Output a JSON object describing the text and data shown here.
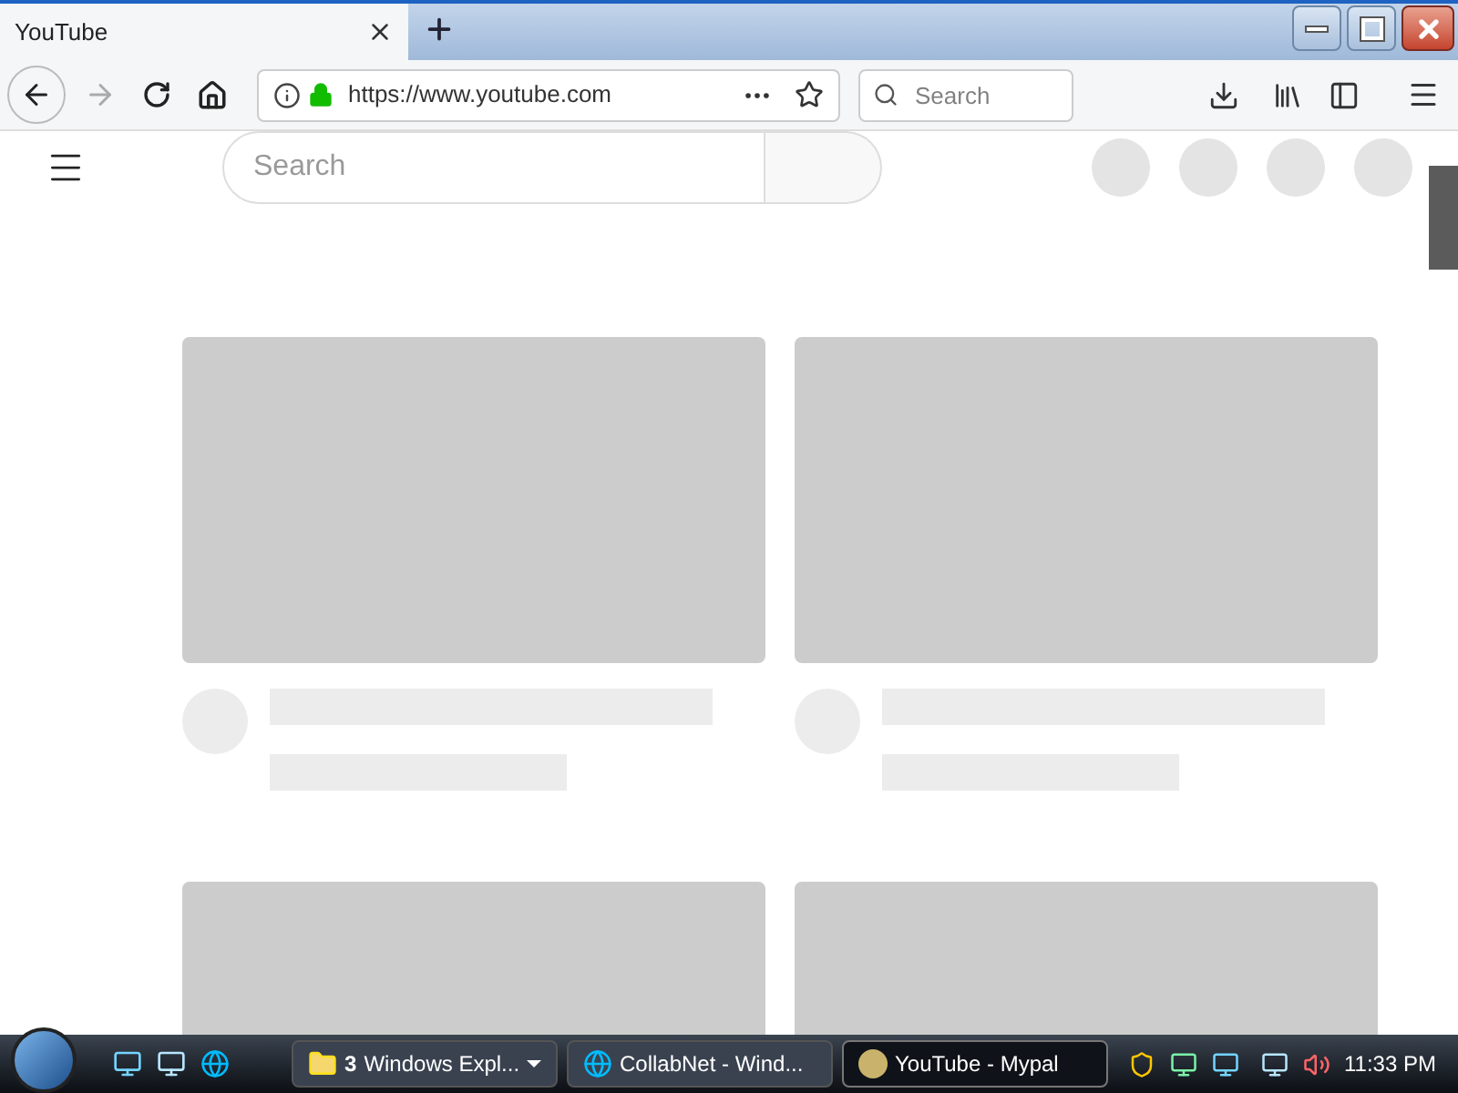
{
  "browser": {
    "tab": {
      "title": "YouTube",
      "selected": true
    },
    "url": "https://www.youtube.com",
    "search": {
      "placeholder": "Search"
    }
  },
  "page": {
    "search": {
      "placeholder": "Search"
    },
    "feed": [
      {
        "kind": "skeleton"
      },
      {
        "kind": "skeleton"
      },
      {
        "kind": "thumbnail"
      },
      {
        "kind": "thumbnail"
      }
    ]
  },
  "taskbar": {
    "items": [
      {
        "count": "3",
        "label": "Windows Expl...",
        "selected": false,
        "grouped": true
      },
      {
        "label": "CollabNet - Wind...",
        "selected": false,
        "grouped": false
      },
      {
        "label": "YouTube - Mypal",
        "selected": true,
        "grouped": false
      }
    ],
    "clock": "11:33 PM"
  }
}
